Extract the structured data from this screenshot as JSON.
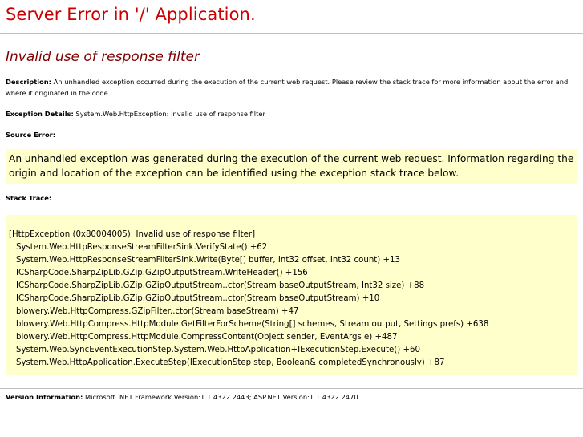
{
  "page": {
    "title": "Server Error in '/' Application.",
    "subtitle": "Invalid use of response filter"
  },
  "description": {
    "label": "Description:",
    "text": "An unhandled exception occurred during the execution of the current web request. Please review the stack trace for more information about the error and where it originated in the code."
  },
  "exception_details": {
    "label": "Exception Details:",
    "text": "System.Web.HttpException: Invalid use of response filter"
  },
  "source_error": {
    "label": "Source Error:",
    "text": "An unhandled exception was generated during the execution of the current web request. Information regarding the origin and location of the exception can be identified using the exception stack trace below."
  },
  "stack_trace": {
    "label": "Stack Trace:",
    "lines": [
      "[HttpException (0x80004005): Invalid use of response filter]",
      "System.Web.HttpResponseStreamFilterSink.VerifyState() +62",
      "System.Web.HttpResponseStreamFilterSink.Write(Byte[] buffer, Int32 offset, Int32 count) +13",
      "ICSharpCode.SharpZipLib.GZip.GZipOutputStream.WriteHeader() +156",
      "ICSharpCode.SharpZipLib.GZip.GZipOutputStream..ctor(Stream baseOutputStream, Int32 size) +88",
      "ICSharpCode.SharpZipLib.GZip.GZipOutputStream..ctor(Stream baseOutputStream) +10",
      "blowery.Web.HttpCompress.GZipFilter..ctor(Stream baseStream) +47",
      "blowery.Web.HttpCompress.HttpModule.GetFilterForScheme(String[] schemes, Stream output, Settings prefs) +638",
      "blowery.Web.HttpCompress.HttpModule.CompressContent(Object sender, EventArgs e) +487",
      "System.Web.SyncEventExecutionStep.System.Web.HttpApplication+IExecutionStep.Execute() +60",
      "System.Web.HttpApplication.ExecuteStep(IExecutionStep step, Boolean& completedSynchronously) +87"
    ]
  },
  "version_info": {
    "label": "Version Information:",
    "text": "Microsoft .NET Framework Version:1.1.4322.2443; ASP.NET Version:1.1.4322.2470"
  },
  "colors": {
    "title": "#cc0000",
    "subtitle": "#800000",
    "code_background": "#ffffcc",
    "rule": "#c0c0c0"
  }
}
